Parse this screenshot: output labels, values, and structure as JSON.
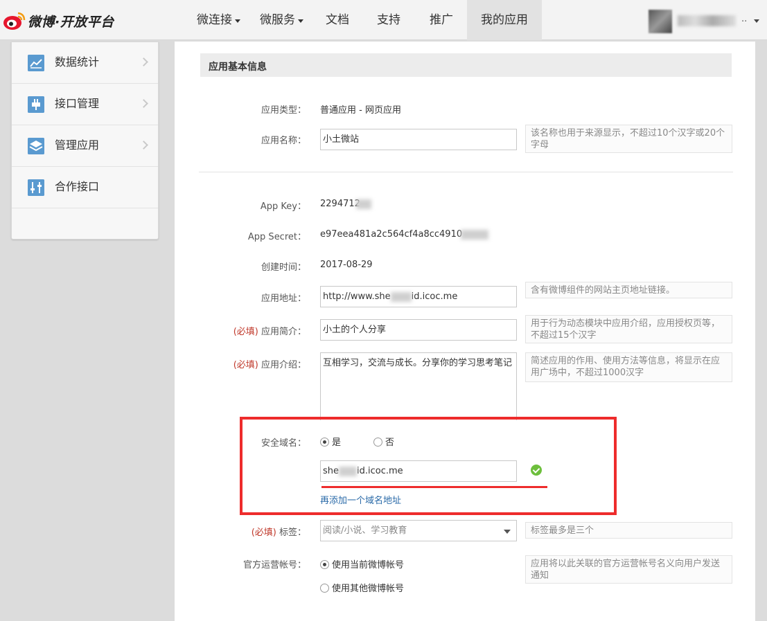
{
  "header": {
    "logo_text": "微博·开放平台",
    "nav": [
      {
        "label": "微连接",
        "has_caret": true
      },
      {
        "label": "微服务",
        "has_caret": true
      },
      {
        "label": "文档",
        "has_caret": false
      },
      {
        "label": "支持",
        "has_caret": false
      },
      {
        "label": "推广",
        "has_caret": false
      },
      {
        "label": "我的应用",
        "has_caret": false,
        "active": true
      }
    ],
    "user_suffix": ".."
  },
  "sidebar": {
    "items": [
      {
        "label": "数据统计",
        "icon": "chart-icon"
      },
      {
        "label": "接口管理",
        "icon": "plug-icon"
      },
      {
        "label": "管理应用",
        "icon": "layers-icon"
      },
      {
        "label": "合作接口",
        "icon": "sliders-icon"
      }
    ]
  },
  "section": {
    "title": "应用基本信息"
  },
  "form": {
    "app_type": {
      "label": "应用类型：",
      "value": "普通应用 - 网页应用"
    },
    "app_name": {
      "label": "应用名称：",
      "value": "小土微站",
      "hint": "该名称也用于来源显示，不超过10个汉字或20个字母"
    },
    "app_key": {
      "label": "App Key：",
      "value": "2294712"
    },
    "app_secret": {
      "label": "App Secret：",
      "value": "e97eea481a2c564cf4a8cc4910"
    },
    "created": {
      "label": "创建时间：",
      "value": "2017-08-29"
    },
    "app_url": {
      "label": "应用地址：",
      "value_prefix": "http://www.she",
      "value_suffix": "id.icoc.me",
      "hint": "含有微博组件的网站主页地址链接。"
    },
    "required_mark": "(必填)",
    "app_brief": {
      "label": "应用简介：",
      "value": "小土的个人分享",
      "hint": "用于行为动态模块中应用介绍，应用授权页等，不超过15个汉字"
    },
    "app_desc": {
      "label": "应用介绍：",
      "value": "互相学习，交流与成长。分享你的学习思考笔记",
      "hint": "简述应用的作用、使用方法等信息，将显示在应用广场中，不超过1000汉字"
    },
    "secure_domain": {
      "label": "安全域名：",
      "option_yes": "是",
      "option_no": "否",
      "selected": "是",
      "value_prefix": "she",
      "value_suffix": "id.icoc.me",
      "add_link": "再添加一个域名地址"
    },
    "tags": {
      "label": "标签：",
      "value": "阅读/小说、学习教育",
      "hint": "标签最多是三个"
    },
    "official_account": {
      "label": "官方运营帐号：",
      "option_current": "使用当前微博帐号",
      "option_other": "使用其他微博帐号",
      "selected": "使用当前微博帐号",
      "hint": "应用将以此关联的官方运营帐号名义向用户发送通知"
    }
  },
  "colors": {
    "accent_red": "#ee2c2c",
    "link_blue": "#2a6aa8",
    "success_green": "#6dbf3c",
    "required_red": "#c0392b"
  }
}
